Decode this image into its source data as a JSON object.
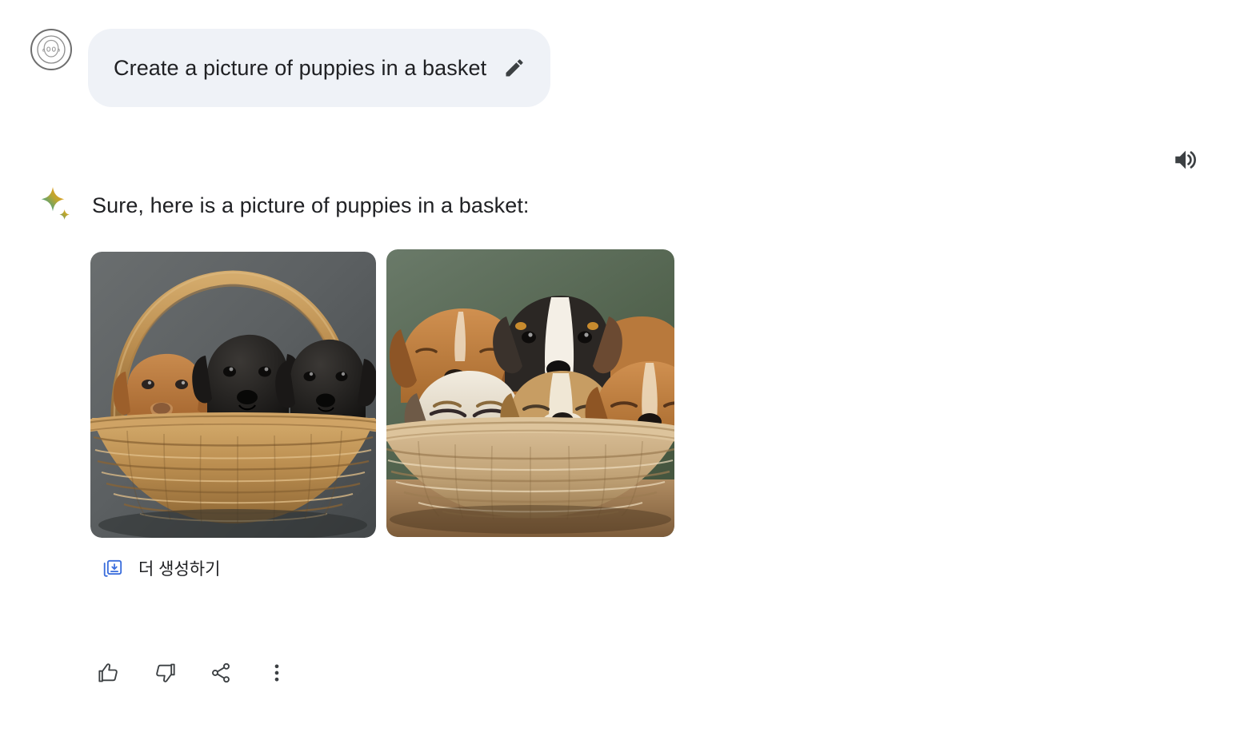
{
  "user_turn": {
    "avatar_icon": "user-avatar-icon",
    "prompt_text": "Create a picture of puppies in a basket",
    "edit_icon": "pencil-edit-icon"
  },
  "toolbar": {
    "speaker_icon": "volume-speaker-icon"
  },
  "assistant_turn": {
    "sparkle_icon": "sparkle-icon",
    "response_text": "Sure, here is a picture of puppies in a basket:",
    "images": [
      {
        "name": "generated-image-1",
        "alt": "Three puppies in a wicker basket with handle on gray background",
        "background": "#5d6163",
        "basket_color": "#c49a5e"
      },
      {
        "name": "generated-image-2",
        "alt": "Five puppies cuddled in a wicker basket on sage green background",
        "background": "#5a6b5a",
        "basket_color": "#c8ab82"
      }
    ],
    "generate_more": {
      "icon": "add-photo-library-icon",
      "label": "더 생성하기",
      "icon_color": "#3a6ddc"
    },
    "actions": [
      {
        "name": "thumb-up-button",
        "icon": "thumb-up-icon"
      },
      {
        "name": "thumb-down-button",
        "icon": "thumb-down-icon"
      },
      {
        "name": "share-button",
        "icon": "share-icon"
      },
      {
        "name": "more-options-button",
        "icon": "more-vert-icon"
      }
    ]
  },
  "colors": {
    "prompt_bubble_bg": "#eff2f7",
    "text_primary": "#202124",
    "icon_stroke": "#3c4043",
    "accent_blue": "#3a6ddc"
  }
}
